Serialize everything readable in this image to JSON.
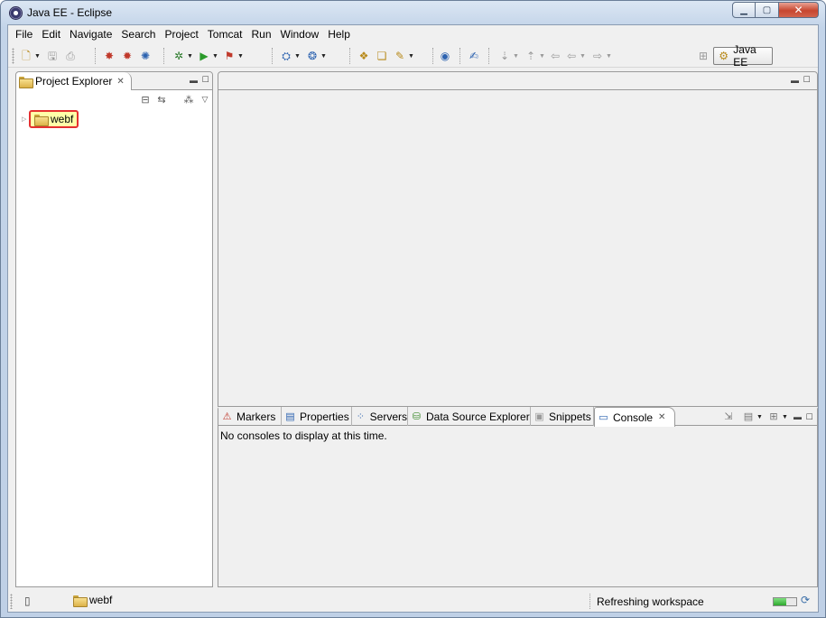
{
  "window": {
    "title": "Java EE - Eclipse"
  },
  "menubar": [
    "File",
    "Edit",
    "Navigate",
    "Search",
    "Project",
    "Tomcat",
    "Run",
    "Window",
    "Help"
  ],
  "perspective": {
    "label": "Java EE"
  },
  "project_explorer": {
    "tab_label": "Project Explorer",
    "tree": [
      {
        "label": "webf",
        "type": "project",
        "highlighted": true
      }
    ]
  },
  "bottom_panel": {
    "tabs": [
      "Markers",
      "Properties",
      "Servers",
      "Data Source Explorer",
      "Snippets",
      "Console"
    ],
    "active_tab": "Console",
    "console_message": "No consoles to display at this time."
  },
  "statusbar": {
    "selection": "webf",
    "message": "Refreshing workspace",
    "progress": 0.55
  },
  "colors": {
    "highlight_border": "#e53030",
    "highlight_fill": "#ffffa8",
    "titlebar": "#c3d4e9"
  }
}
